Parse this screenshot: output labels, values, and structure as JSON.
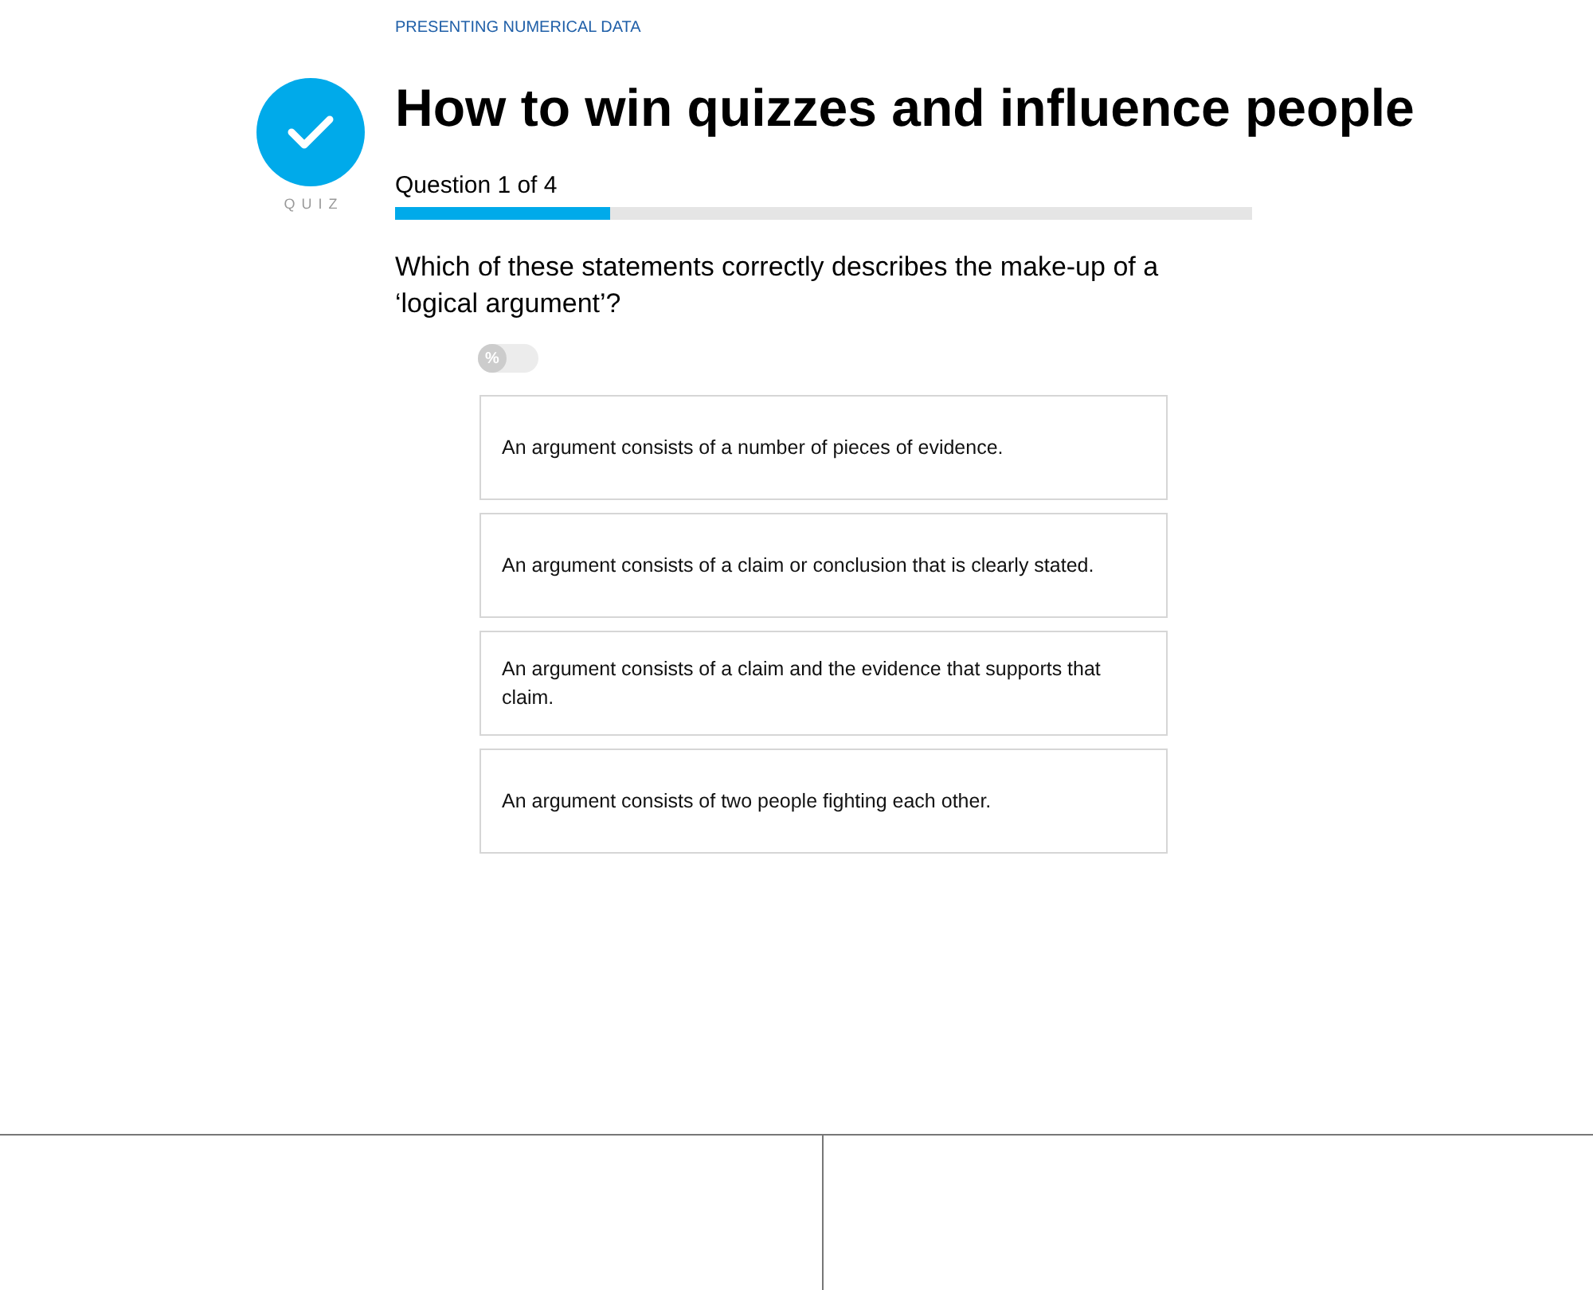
{
  "breadcrumb": "PRESENTING NUMERICAL DATA",
  "badge": {
    "label": "QUIZ"
  },
  "title": "How to win quizzes and influence people",
  "progress": {
    "label": "Question 1 of 4",
    "level": 0.25
  },
  "question": "Which of these statements correctly describes the make-up of a ‘logical argument’?",
  "percent_toggle": {
    "symbol": "%",
    "on": false
  },
  "options": [
    {
      "text": "An argument consists of a number of pieces of evidence.",
      "selected": false
    },
    {
      "text": "An argument consists of a claim or conclusion that is clearly stated.",
      "selected": false
    },
    {
      "text": "An argument consists of a claim and the evidence that supports that claim.",
      "selected": false
    },
    {
      "text": "An argument consists of two people fighting each other.",
      "selected": false
    }
  ]
}
